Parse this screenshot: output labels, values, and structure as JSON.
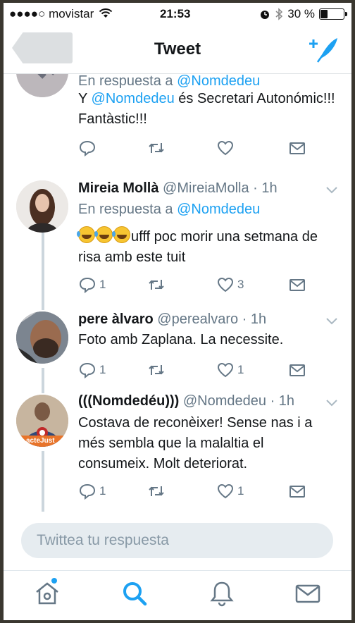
{
  "status_bar": {
    "carrier": "●●●●○ movistar",
    "time": "21:53",
    "battery": "30 %",
    "battery_level": 0.3
  },
  "nav": {
    "title": "Tweet"
  },
  "tweets": [
    {
      "reply_prefix": "En respuesta a",
      "reply_handle": "@Nomdedeu",
      "body_start": "Y ",
      "body_mention": "@Nomdedeu",
      "body_end": " és Secretari Autonómic!!! Fantàstic!!!",
      "replies": "",
      "likes": ""
    },
    {
      "name": "Mireia Mollà",
      "handle": "@MireiaMolla",
      "time": "· 1h",
      "reply_prefix": "En respuesta a",
      "reply_handle": "@Nomdedeu",
      "body": "ufff poc morir una setmana de risa amb este tuit",
      "replies": "1",
      "likes": "3"
    },
    {
      "name": "pere àlvaro",
      "handle": "@perealvaro",
      "time": "· 1h",
      "body": "Foto amb Zaplana. La necessite.",
      "replies": "1",
      "likes": "1"
    },
    {
      "name": "(((Nomdedéu)))",
      "handle": "@Nomdedeu",
      "time": "· 1h",
      "body": "Costava de reconèixer! Sense nas i a més sembla que la malaltia el consumeix. Molt deteriorat.",
      "avatar_text": "acteJust",
      "replies": "1",
      "likes": "1"
    }
  ],
  "reply_box": {
    "placeholder": "Twittea tu respuesta"
  },
  "tabbar": {
    "items": [
      "home-icon",
      "search-icon",
      "notifications-icon",
      "messages-icon"
    ],
    "active": "search-icon"
  },
  "colors": {
    "accent": "#1da1f2",
    "text": "#14171a",
    "secondary": "#657786"
  }
}
